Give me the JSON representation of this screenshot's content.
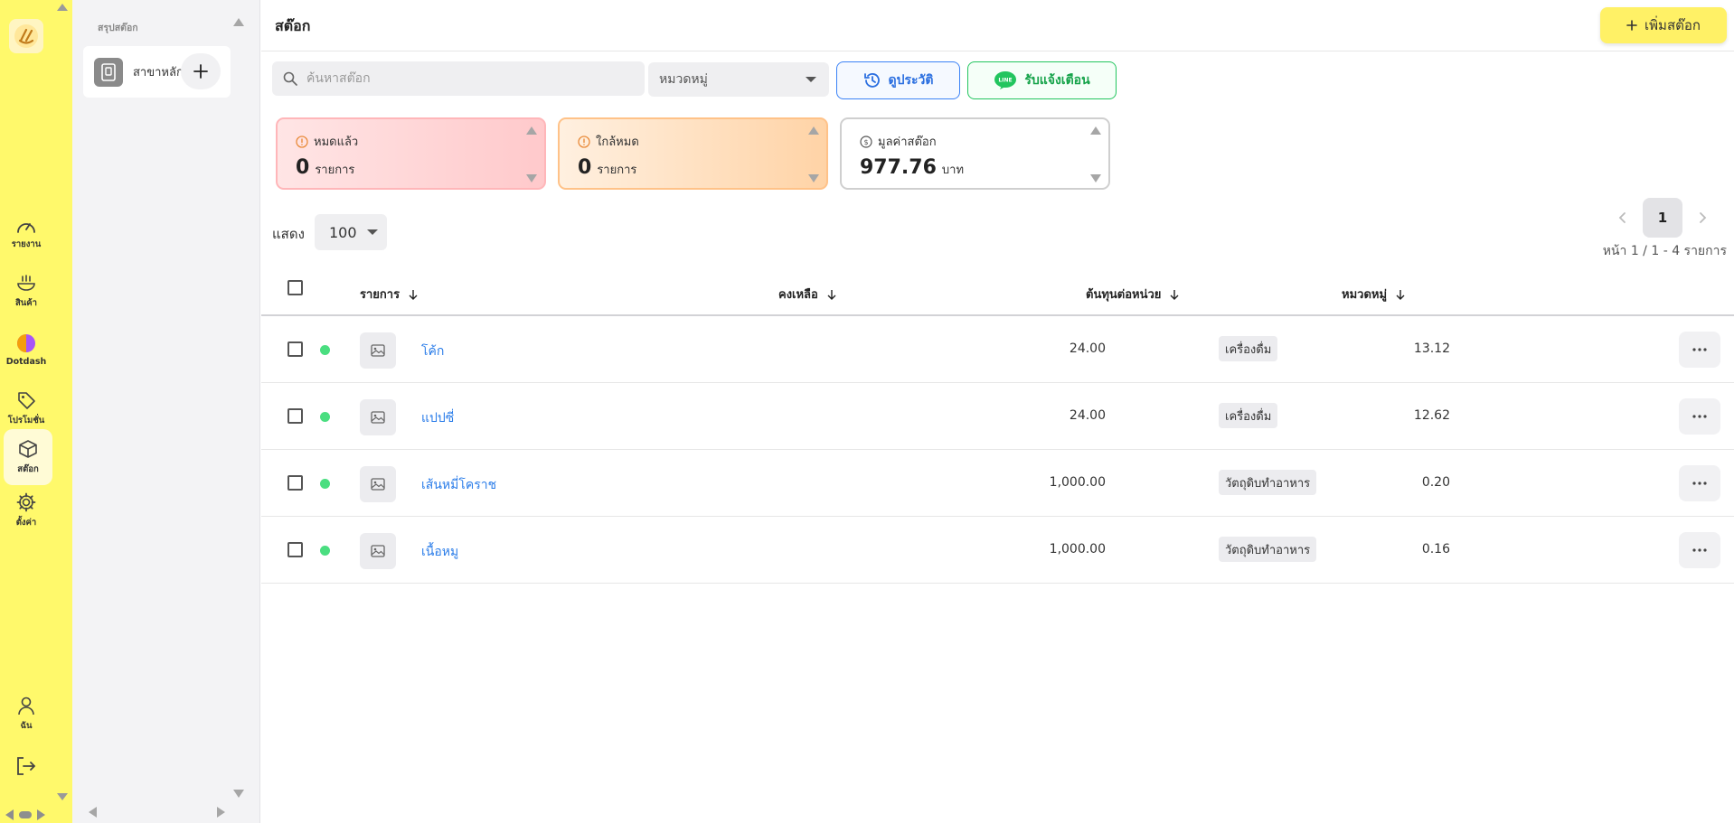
{
  "rail": {
    "items": [
      {
        "key": "report",
        "label": "รายงาน",
        "icon": "gauge-icon"
      },
      {
        "key": "products",
        "label": "สินค้า",
        "icon": "food-bowl-icon"
      },
      {
        "key": "dotdash",
        "label": "Dotdash",
        "icon": "dotdash-logo-icon"
      },
      {
        "key": "promotion",
        "label": "โปรโมชั่น",
        "icon": "tag-icon"
      },
      {
        "key": "stock",
        "label": "สต๊อก",
        "icon": "box-icon",
        "active": true
      },
      {
        "key": "settings",
        "label": "ตั้งค่า",
        "icon": "gear-icon"
      }
    ],
    "user_label": "ฉัน"
  },
  "branch_panel": {
    "heading": "สรุปสต๊อก",
    "branch_name": "สาขาหลัก"
  },
  "header": {
    "title": "สต๊อก",
    "add_stock_label": "เพิ่มสต๊อก"
  },
  "filters": {
    "search_placeholder": "ค้นหาสต๊อก",
    "category_placeholder": "หมวดหมู่",
    "history_label": "ดูประวัติ",
    "line_label": "รับแจ้งเตือน",
    "line_badge": "LINE"
  },
  "stats": {
    "out_of_stock": {
      "label": "หมดแล้ว",
      "value": "0",
      "unit": "รายการ"
    },
    "low_stock": {
      "label": "ใกล้หมด",
      "value": "0",
      "unit": "รายการ"
    },
    "stock_value": {
      "label": "มูลค่าสต๊อก",
      "value": "977.76",
      "unit": "บาท"
    }
  },
  "pagination": {
    "show_label": "แสดง",
    "page_size": "100",
    "current_page": "1",
    "info": "หน้า 1 / 1 - 4 รายการ"
  },
  "table": {
    "columns": {
      "item": "รายการ",
      "remaining": "คงเหลือ",
      "unit_cost": "ต้นทุนต่อหน่วย",
      "category": "หมวดหมู่"
    },
    "rows": [
      {
        "name": "โค้ก",
        "remaining": "24.00",
        "unit_cost": "13.12",
        "category": "เครื่องดื่ม"
      },
      {
        "name": "แปปซี่",
        "remaining": "24.00",
        "unit_cost": "12.62",
        "category": "เครื่องดื่ม"
      },
      {
        "name": "เส้นหมี่โคราช",
        "remaining": "1,000.00",
        "unit_cost": "0.20",
        "category": "วัตถุดิบทำอาหาร"
      },
      {
        "name": "เนื้อหมู",
        "remaining": "1,000.00",
        "unit_cost": "0.16",
        "category": "วัตถุดิบทำอาหาร"
      }
    ]
  },
  "colors": {
    "rail_bg": "#fff96b",
    "accent_yellow": "#fff166",
    "link_blue": "#2b7de9",
    "status_green": "#4ade80",
    "line_green": "#22c55e"
  }
}
